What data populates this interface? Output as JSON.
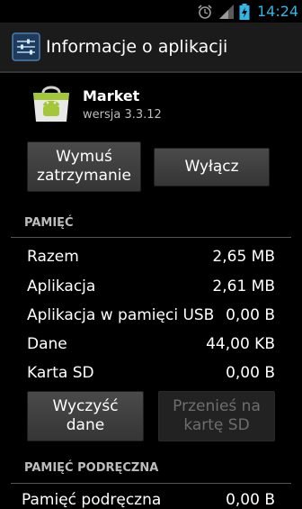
{
  "status_bar": {
    "time": "14:24"
  },
  "action_bar": {
    "title": "Informacje o aplikacji",
    "icon": "settings-icon"
  },
  "app": {
    "name": "Market",
    "version": "wersja 3.3.12"
  },
  "buttons": {
    "force_stop": "Wymuś zatrzymanie",
    "disable": "Wyłącz",
    "clear_data": "Wyczyść dane",
    "move_to_sd": "Przenieś na kartę SD"
  },
  "storage": {
    "header": "PAMIĘĆ",
    "rows": [
      {
        "label": "Razem",
        "value": "2,65 MB"
      },
      {
        "label": "Aplikacja",
        "value": "2,61 MB"
      },
      {
        "label": "Aplikacja w pamięci USB",
        "value": "0,00 B"
      },
      {
        "label": "Dane",
        "value": "44,00 KB"
      },
      {
        "label": "Karta SD",
        "value": "0,00 B"
      }
    ]
  },
  "cache": {
    "header": "PAMIĘĆ PODRĘCZNA",
    "rows": [
      {
        "label": "Pamięć podręczna",
        "value": "0,00 B"
      }
    ]
  },
  "colors": {
    "accent": "#33b5e5",
    "background": "#000000"
  }
}
